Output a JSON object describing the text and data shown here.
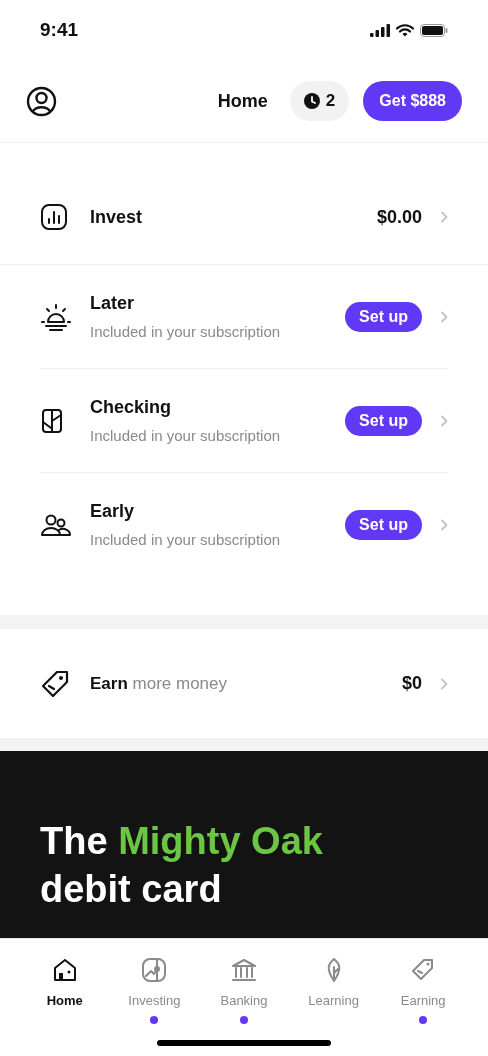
{
  "status_bar": {
    "time": "9:41"
  },
  "header": {
    "title": "Home",
    "pending_count": "2",
    "cta": "Get $888"
  },
  "accounts": [
    {
      "kind": "value",
      "title": "Invest",
      "value": "$0.00"
    },
    {
      "kind": "setup",
      "title": "Later",
      "subtitle": "Included in your subscription",
      "action": "Set up"
    },
    {
      "kind": "setup",
      "title": "Checking",
      "subtitle": "Included in your subscription",
      "action": "Set up"
    },
    {
      "kind": "setup",
      "title": "Early",
      "subtitle": "Included in your subscription",
      "action": "Set up"
    }
  ],
  "earn": {
    "label": "**Earn** more money",
    "value": "$0"
  },
  "promo": {
    "before": "The",
    "highlight": "Mighty Oak",
    "after": "debit card"
  },
  "tabs": [
    {
      "label": "Home",
      "selected": true,
      "has_dot": false
    },
    {
      "label": "Investing",
      "selected": false,
      "has_dot": true
    },
    {
      "label": "Banking",
      "selected": false,
      "has_dot": true
    },
    {
      "label": "Learning",
      "selected": false,
      "has_dot": false
    },
    {
      "label": "Earning",
      "selected": false,
      "has_dot": true
    }
  ]
}
